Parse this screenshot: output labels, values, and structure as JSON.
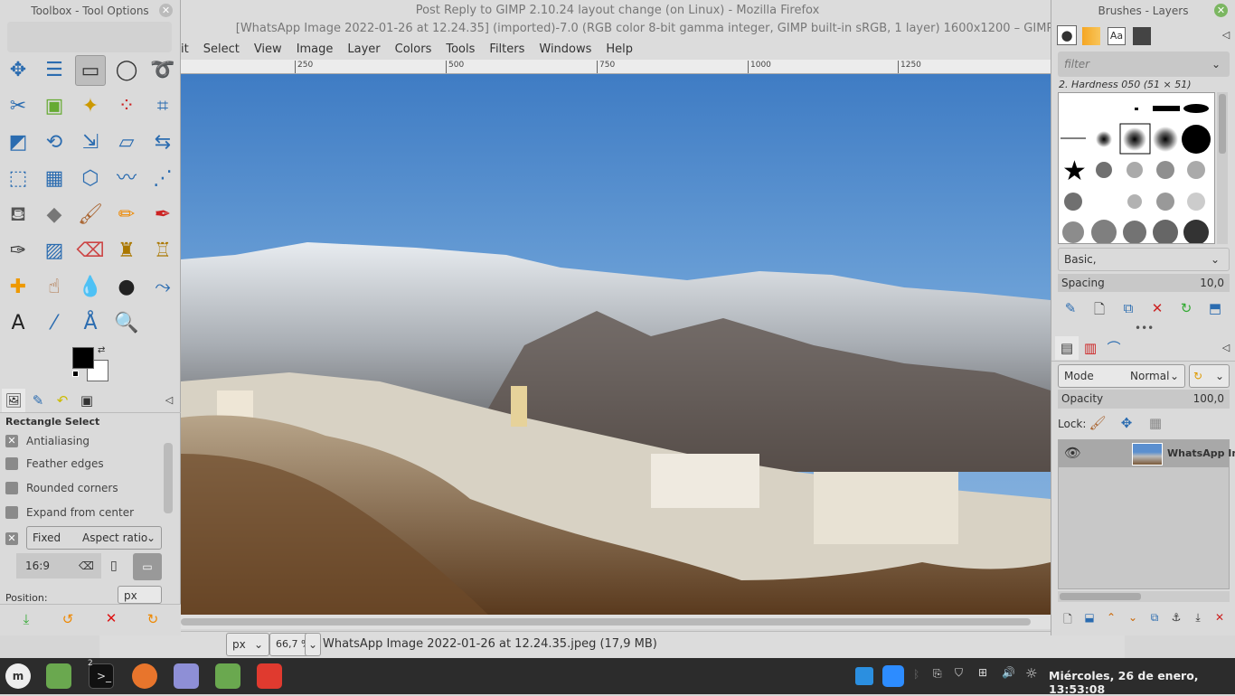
{
  "firefox_title": "Post Reply to GIMP 2.10.24 layout change (on Linux) - Mozilla Firefox",
  "gimp_title": "[WhatsApp Image 2022-01-26 at 12.24.35] (imported)-7.0 (RGB color 8-bit gamma integer, GIMP built-in sRGB, 1 layer) 1600x1200 – GIMP",
  "menu": [
    "it",
    "Select",
    "View",
    "Image",
    "Layer",
    "Colors",
    "Tools",
    "Filters",
    "Windows",
    "Help"
  ],
  "ruler_ticks": [
    "250",
    "500",
    "750",
    "1000",
    "1250"
  ],
  "status": {
    "unit": "px",
    "zoom": "66,7 %",
    "file": "WhatsApp Image 2022-01-26 at 12.24.35.jpeg (17,9 MB)"
  },
  "toolbox": {
    "title": "Toolbox - Tool Options",
    "tools": [
      {
        "name": "move",
        "g": "✥",
        "c": "#2b6cb0"
      },
      {
        "name": "align",
        "g": "☰",
        "c": "#2b6cb0"
      },
      {
        "name": "rect-select",
        "g": "▭",
        "c": "#333"
      },
      {
        "name": "ellipse-select",
        "g": "◯",
        "c": "#333"
      },
      {
        "name": "free-select",
        "g": "➰",
        "c": "#555"
      },
      {
        "name": "scissors",
        "g": "✂",
        "c": "#2b6cb0"
      },
      {
        "name": "foreground-select",
        "g": "▣",
        "c": "#6a3"
      },
      {
        "name": "fuzzy-select",
        "g": "✦",
        "c": "#c90"
      },
      {
        "name": "color-select",
        "g": "⁘",
        "c": "#c22"
      },
      {
        "name": "crop",
        "g": "⌗",
        "c": "#2b6cb0"
      },
      {
        "name": "unified-transform",
        "g": "◩",
        "c": "#2b6cb0"
      },
      {
        "name": "rotate",
        "g": "⟲",
        "c": "#2b6cb0"
      },
      {
        "name": "scale",
        "g": "⇲",
        "c": "#2b6cb0"
      },
      {
        "name": "shear",
        "g": "▱",
        "c": "#2b6cb0"
      },
      {
        "name": "flip",
        "g": "⇆",
        "c": "#2b6cb0"
      },
      {
        "name": "perspective",
        "g": "⬚",
        "c": "#2b6cb0"
      },
      {
        "name": "3d-transform",
        "g": "▦",
        "c": "#2b6cb0"
      },
      {
        "name": "cage",
        "g": "⬡",
        "c": "#2b6cb0"
      },
      {
        "name": "warp",
        "g": "〰",
        "c": "#2b6cb0"
      },
      {
        "name": "handle-transform",
        "g": "⋰",
        "c": "#2b6cb0"
      },
      {
        "name": "bucket-fill",
        "g": "⛾",
        "c": "#555"
      },
      {
        "name": "gradient",
        "g": "◆",
        "c": "#777"
      },
      {
        "name": "paintbrush",
        "g": "🖌",
        "c": "#a63"
      },
      {
        "name": "pencil",
        "g": "✏",
        "c": "#e80"
      },
      {
        "name": "airbrush",
        "g": "✒",
        "c": "#c22"
      },
      {
        "name": "ink",
        "g": "✑",
        "c": "#333"
      },
      {
        "name": "mypaint-brush",
        "g": "▨",
        "c": "#2b6cb0"
      },
      {
        "name": "eraser",
        "g": "⌫",
        "c": "#c44"
      },
      {
        "name": "clone",
        "g": "♜",
        "c": "#a70"
      },
      {
        "name": "perspective-clone",
        "g": "♖",
        "c": "#a70"
      },
      {
        "name": "heal",
        "g": "✚",
        "c": "#e90"
      },
      {
        "name": "smudge",
        "g": "☝",
        "c": "#a63"
      },
      {
        "name": "blur",
        "g": "💧",
        "c": "#2b6cb0"
      },
      {
        "name": "dodge-burn",
        "g": "●",
        "c": "#222"
      },
      {
        "name": "paths",
        "g": "⤳",
        "c": "#2b6cb0"
      },
      {
        "name": "text",
        "g": "A",
        "c": "#222"
      },
      {
        "name": "color-picker",
        "g": "⁄",
        "c": "#2b6cb0"
      },
      {
        "name": "measure",
        "g": "Å",
        "c": "#2b6cb0"
      },
      {
        "name": "zoom",
        "g": "🔍",
        "c": "#2b6cb0"
      }
    ],
    "options_title": "Rectangle Select",
    "antialiasing": "Antialiasing",
    "feather": "Feather edges",
    "rounded": "Rounded corners",
    "expand": "Expand from center",
    "fixed": "Fixed",
    "fixed_mode": "Aspect ratio",
    "ratio": "16:9",
    "position": "Position:",
    "position_unit": "px"
  },
  "right": {
    "title": "Brushes - Layers",
    "filter_placeholder": "filter",
    "brush_name": "2. Hardness 050 (51 × 51)",
    "preset": "Basic,",
    "spacing_label": "Spacing",
    "spacing_value": "10,0",
    "mode_label": "Mode",
    "mode_value": "Normal",
    "opacity_label": "Opacity",
    "opacity_value": "100,0",
    "lock_label": "Lock:",
    "layer_name": "WhatsApp Im"
  },
  "clock": "Miércoles, 26 de enero, 13:53:08",
  "terminal_badge": "2"
}
